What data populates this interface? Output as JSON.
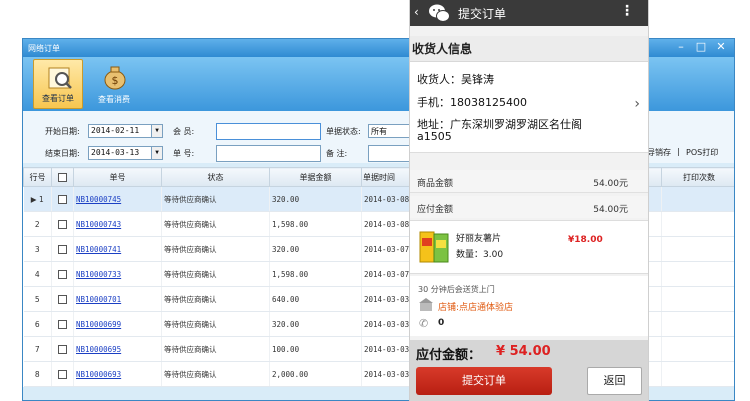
{
  "window": {
    "title": "网络订单",
    "ribbon": [
      {
        "label": "查看订单",
        "icon": "order-search-icon",
        "active": true
      },
      {
        "label": "查看消费",
        "icon": "money-bag-icon",
        "active": false
      }
    ]
  },
  "filters": {
    "start_label": "开始日期:",
    "start_value": "2014-02-11",
    "end_label": "结束日期:",
    "end_value": "2014-03-13",
    "member_label": "会    员:",
    "member_value": "",
    "order_no_label": "单    号:",
    "order_no_value": "",
    "status_label": "单据状态:",
    "status_value": "所有",
    "remark_label": "备    注:",
    "remark_value": "",
    "action_sales": "导销存",
    "action_sep": "|",
    "action_pos": "POS打印"
  },
  "table": {
    "columns": [
      "行号",
      "",
      "单号",
      "状态",
      "单据金额",
      "单据时间",
      "打印次数"
    ],
    "rows": [
      {
        "no": "1",
        "order": "NB10000745",
        "status": "等待供应商确认",
        "amount": "320.00",
        "time": "2014-03-08",
        "selected": true
      },
      {
        "no": "2",
        "order": "NB10000743",
        "status": "等待供应商确认",
        "amount": "1,598.00",
        "time": "2014-03-08",
        "selected": false
      },
      {
        "no": "3",
        "order": "NB10000741",
        "status": "等待供应商确认",
        "amount": "320.00",
        "time": "2014-03-07",
        "selected": false
      },
      {
        "no": "4",
        "order": "NB10000733",
        "status": "等待供应商确认",
        "amount": "1,598.00",
        "time": "2014-03-07",
        "selected": false
      },
      {
        "no": "5",
        "order": "NB10000701",
        "status": "等待供应商确认",
        "amount": "640.00",
        "time": "2014-03-03",
        "selected": false
      },
      {
        "no": "6",
        "order": "NB10000699",
        "status": "等待供应商确认",
        "amount": "320.00",
        "time": "2014-03-03",
        "selected": false
      },
      {
        "no": "7",
        "order": "NB10000695",
        "status": "等待供应商确认",
        "amount": "100.00",
        "time": "2014-03-03",
        "selected": false
      },
      {
        "no": "8",
        "order": "NB10000693",
        "status": "等待供应商确认",
        "amount": "2,000.00",
        "time": "2014-03-03",
        "selected": false
      }
    ]
  },
  "phone": {
    "back": "‹",
    "title": "提交订单",
    "more": "⋮",
    "section_title": "收货人信息",
    "receiver": "收货人：吴锋涛",
    "phone": "手机：18038125400",
    "address_line1": "地址：广东深圳罗湖罗湖区名仕阁",
    "address_line2": "a1505",
    "goods_amount_label": "商品金额",
    "goods_amount_value": "54.00元",
    "payable_label": "应付金额",
    "payable_value": "54.00元",
    "item_name": "好丽友薯片",
    "item_qty": "数量：3.00",
    "item_price": "¥18.00",
    "delivery_note": "30 分钟后会送货上门",
    "store": "店铺:点店通体验店",
    "contact": "0",
    "pay_label": "应付金额：",
    "pay_amount": "¥ 54.00",
    "submit_label": "提交订单",
    "back_label": "返回"
  },
  "colors": {
    "accent_red": "#d22222",
    "window_blue": "#3c97dc",
    "link_blue": "#1b3fc4"
  }
}
